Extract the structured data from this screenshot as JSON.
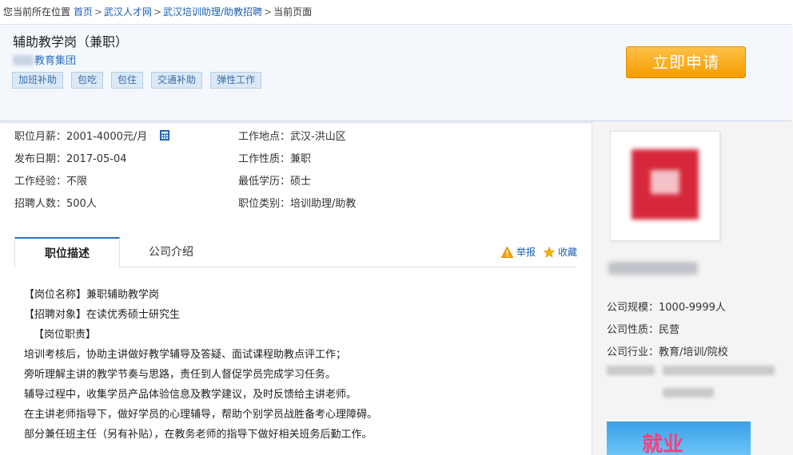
{
  "breadcrumb": {
    "prefix": "您当前所在位置",
    "items": [
      "首页",
      "武汉人才网",
      "武汉培训助理/助教招聘"
    ],
    "current": "当前页面",
    "sep": ">"
  },
  "job": {
    "title": "辅助教学岗（兼职）",
    "company_suffix": "教育集团",
    "tags": [
      "加班补助",
      "包吃",
      "包住",
      "交通补助",
      "弹性工作"
    ],
    "apply_label": "立即申请"
  },
  "info": {
    "salary": "职位月薪：2001-4000元/月",
    "location": "工作地点：武汉-洪山区",
    "date": "发布日期：2017-05-04",
    "nature": "工作性质：兼职",
    "experience": "工作经验：不限",
    "education": "最低学历：硕士",
    "headcount": "招聘人数：500人",
    "category": "职位类别：培训助理/助教"
  },
  "tabs": {
    "active": "职位描述",
    "inactive": "公司介绍",
    "report": "举报",
    "favorite": "收藏"
  },
  "description": [
    "【岗位名称】兼职辅助教学岗",
    "【招聘对象】在读优秀硕士研究生",
    "【岗位职责】",
    "培训考核后，协助主讲做好教学辅导及答疑、面试课程助教点评工作；",
    "旁听理解主讲的教学节奏与思路，责任到人督促学员完成学习任务。",
    "辅导过程中，收集学员产品体验信息及教学建议，及时反馈给主讲老师。",
    "在主讲老师指导下，做好学员的心理辅导，帮助个别学员战胜备考心理障碍。",
    "部分兼任班主任（另有补贴），在教务老师的指导下做好相关班务后勤工作。"
  ],
  "sidebar": {
    "size": "公司规模：1000-9999人",
    "type": "公司性质：民营",
    "industry": "公司行业：教育/培训/院校",
    "banner_text": "就业"
  },
  "colors": {
    "link": "#1a5fb4",
    "accent_orange": "#f59b00",
    "tab_active": "#2a72c8"
  }
}
